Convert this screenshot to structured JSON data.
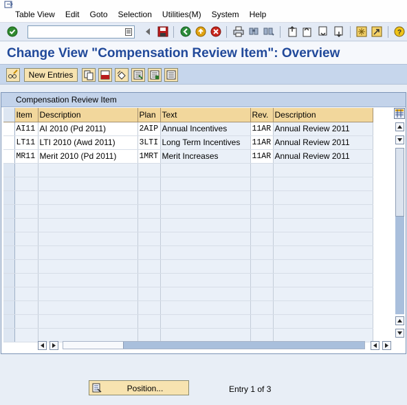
{
  "menu": {
    "items": [
      "Table View",
      "Edit",
      "Goto",
      "Selection",
      "Utilities(M)",
      "System",
      "Help"
    ]
  },
  "toolbar": {
    "command_value": "",
    "icons": [
      "enter-icon",
      "save-icon",
      "back-icon",
      "exit-icon",
      "cancel-icon",
      "print-icon",
      "find-icon",
      "find-next-icon",
      "first-page-icon",
      "previous-page-icon",
      "next-page-icon",
      "last-page-icon",
      "create-session-icon",
      "shortcut-icon",
      "help-icon"
    ]
  },
  "title": "Change View \"Compensation Review Item\": Overview",
  "app_toolbar": {
    "new_entries_label": "New Entries"
  },
  "table": {
    "caption": "Compensation Review Item",
    "columns": [
      "Item",
      "Description",
      "Plan",
      "Text",
      "Rev.",
      "Description"
    ],
    "rows": [
      [
        "AI11",
        "AI 2010 (Pd 2011)",
        "2AIP",
        "Annual Incentives",
        "11AR",
        "Annual Review 2011"
      ],
      [
        "LT11",
        "LTI 2010 (Awd 2011)",
        "3LTI",
        "Long Term Incentives",
        "11AR",
        "Annual Review 2011"
      ],
      [
        "MR11",
        "Merit 2010 (Pd 2011)",
        "1MRT",
        "Merit Increases",
        "11AR",
        "Annual Review 2011"
      ]
    ]
  },
  "bottom": {
    "position_label": "Position...",
    "entry_info": "Entry 1 of 3"
  },
  "colors": {
    "title": "#21499a",
    "button_fill": "#f7e3b0",
    "header_fill": "#f2d79c",
    "app_toolbar": "#c6d6ec"
  }
}
